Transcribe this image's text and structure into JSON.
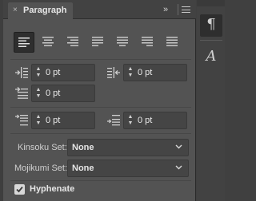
{
  "panel": {
    "title": "Paragraph",
    "close_icon": "×",
    "expand_icon": "»",
    "menu_icon": "panel-menu-icon"
  },
  "alignment": {
    "buttons": [
      {
        "name": "align-left-icon",
        "active": true
      },
      {
        "name": "align-center-icon",
        "active": false
      },
      {
        "name": "align-right-icon",
        "active": false
      },
      {
        "name": "justify-last-left-icon",
        "active": false
      },
      {
        "name": "justify-last-center-icon",
        "active": false
      },
      {
        "name": "justify-last-right-icon",
        "active": false
      },
      {
        "name": "justify-all-icon",
        "active": false
      }
    ]
  },
  "indents": {
    "left_indent": "0 pt",
    "right_indent": "0 pt",
    "first_line_indent": "0 pt"
  },
  "spacing": {
    "space_before": "0 pt",
    "space_after": "0 pt"
  },
  "kinsoku": {
    "label": "Kinsoku Set:",
    "value": "None"
  },
  "mojikumi": {
    "label": "Mojikumi Set:",
    "value": "None"
  },
  "hyphenate": {
    "label": "Hyphenate",
    "checked": true
  },
  "side_panel": {
    "paragraph_glyph": "¶",
    "character_glyph": "A"
  }
}
